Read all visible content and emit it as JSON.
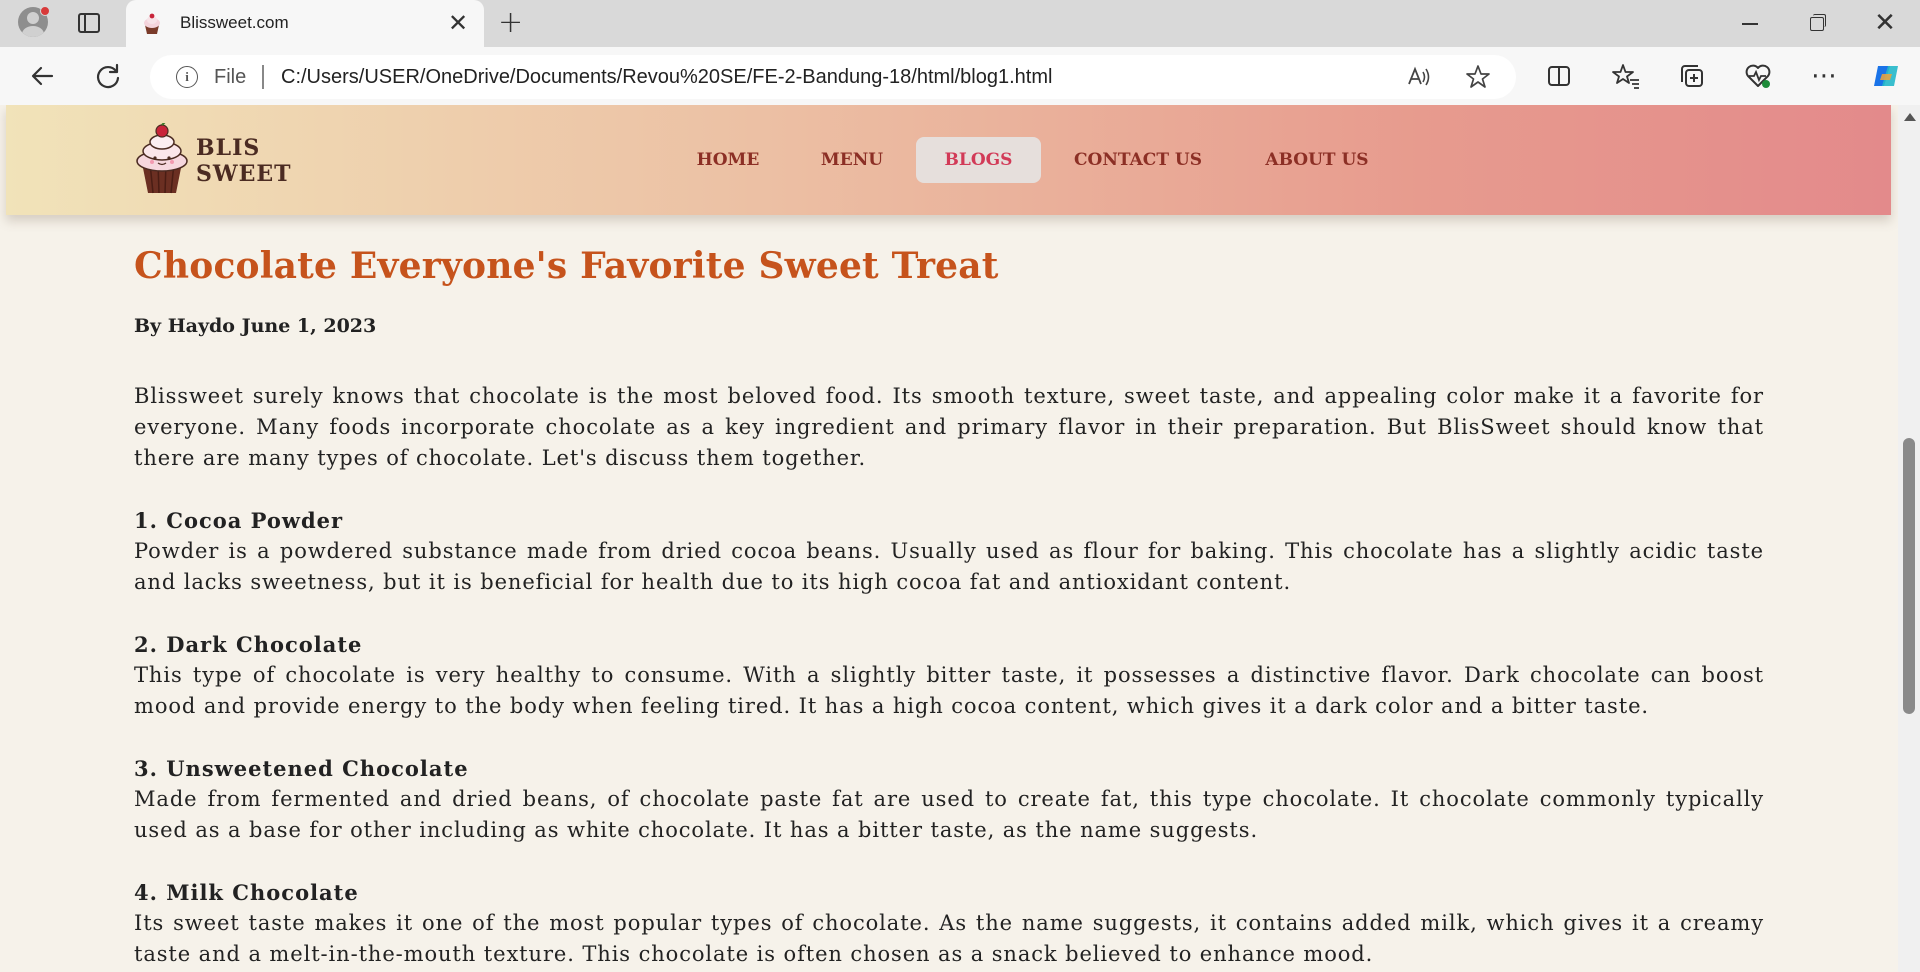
{
  "browser": {
    "tab_title": "Blissweet.com",
    "address_scheme": "File",
    "address_url": "C:/Users/USER/OneDrive/Documents/Revou%20SE/FE-2-Bandung-18/html/blog1.html"
  },
  "site": {
    "logo_line1": "BLIS",
    "logo_line2": "SWEET",
    "nav": [
      {
        "label": "HOME"
      },
      {
        "label": "MENU"
      },
      {
        "label": "BLOGS",
        "active": true
      },
      {
        "label": "CONTACT US"
      },
      {
        "label": "ABOUT US"
      }
    ]
  },
  "article": {
    "title": "Chocolate Everyone's Favorite Sweet Treat",
    "byline": "By Haydo June 1, 2023",
    "intro": "Blissweet surely knows that chocolate is the most beloved food. Its smooth texture, sweet taste, and appealing color make it a favorite for everyone. Many foods incorporate chocolate as a key ingredient and primary flavor in their preparation. But BlisSweet should know that there are many types of chocolate. Let's discuss them together.",
    "sections": [
      {
        "heading": "1. Cocoa Powder",
        "body": "Powder is a powdered substance made from dried cocoa beans. Usually used as flour for baking. This chocolate has a slightly acidic taste and lacks sweetness, but it is beneficial for health due to its high cocoa fat and antioxidant content."
      },
      {
        "heading": "2. Dark Chocolate",
        "body": "This type of chocolate is very healthy to consume. With a slightly bitter taste, it possesses a distinctive flavor. Dark chocolate can boost mood and provide energy to the body when feeling tired. It has a high cocoa content, which gives it a dark color and a bitter taste."
      },
      {
        "heading": "3. Unsweetened Chocolate",
        "body": "Made from fermented and dried beans, of chocolate paste fat are used to create fat, this type chocolate. It chocolate commonly typically used as a base for other including as white chocolate. It has a bitter taste, as the name suggests."
      },
      {
        "heading": "4. Milk Chocolate",
        "body": "Its sweet taste makes it one of the most popular types of chocolate. As the name suggests, it contains added milk, which gives it a creamy taste and a melt-in-the-mouth texture. This chocolate is often chosen as a snack believed to enhance mood."
      }
    ]
  },
  "colors": {
    "title": "#c6531c",
    "nav_text": "#8c2f25",
    "nav_active_text": "#d23a57",
    "header_gradient_start": "#f1e3b9",
    "header_gradient_end": "#e38a8b",
    "page_bg": "#f6f2ea"
  }
}
